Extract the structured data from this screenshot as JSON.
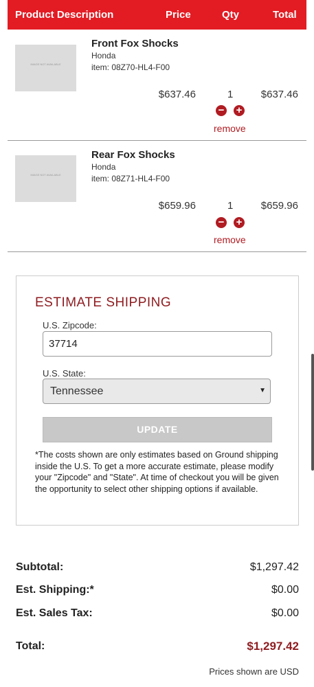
{
  "table_header": {
    "description": "Product Description",
    "price": "Price",
    "qty": "Qty",
    "total": "Total"
  },
  "cart": {
    "items": [
      {
        "name": "Front Fox Shocks",
        "brand": "Honda",
        "item": "item: 08Z70-HL4-F00",
        "price": "$637.46",
        "qty": "1",
        "total": "$637.46",
        "remove": "remove",
        "thumb_text": "IMAGE NOT AVAILABLE",
        "minus_icon": "minus-circle-icon",
        "plus_icon": "plus-circle-icon"
      },
      {
        "name": "Rear Fox Shocks",
        "brand": "Honda",
        "item": "item: 08Z71-HL4-F00",
        "price": "$659.96",
        "qty": "1",
        "total": "$659.96",
        "remove": "remove",
        "thumb_text": "IMAGE NOT AVAILABLE",
        "minus_icon": "minus-circle-icon",
        "plus_icon": "plus-circle-icon"
      }
    ]
  },
  "shipping": {
    "title": "ESTIMATE SHIPPING",
    "zip_label": "U.S. Zipcode:",
    "zip_value": "37714",
    "state_label": "U.S. State:",
    "state_value": "Tennessee",
    "update_label": "UPDATE",
    "note": "*The costs shown are only estimates based on Ground shipping inside the U.S. To get a more accurate estimate, please modify your \"Zipcode\" and \"State\". At time of checkout you will be given the opportunity to select other shipping options if available."
  },
  "summary": {
    "subtotal_label": "Subtotal:",
    "subtotal_value": "$1,297.42",
    "shipping_label": "Est. Shipping:*",
    "shipping_value": "$0.00",
    "tax_label": "Est. Sales Tax:",
    "tax_value": "$0.00",
    "total_label": "Total:",
    "total_value": "$1,297.42",
    "usd_note": "Prices shown are USD"
  },
  "colors": {
    "header_red": "#e31b23",
    "accent_dark_red": "#8e1b1f",
    "remove_red": "#b01c22"
  }
}
